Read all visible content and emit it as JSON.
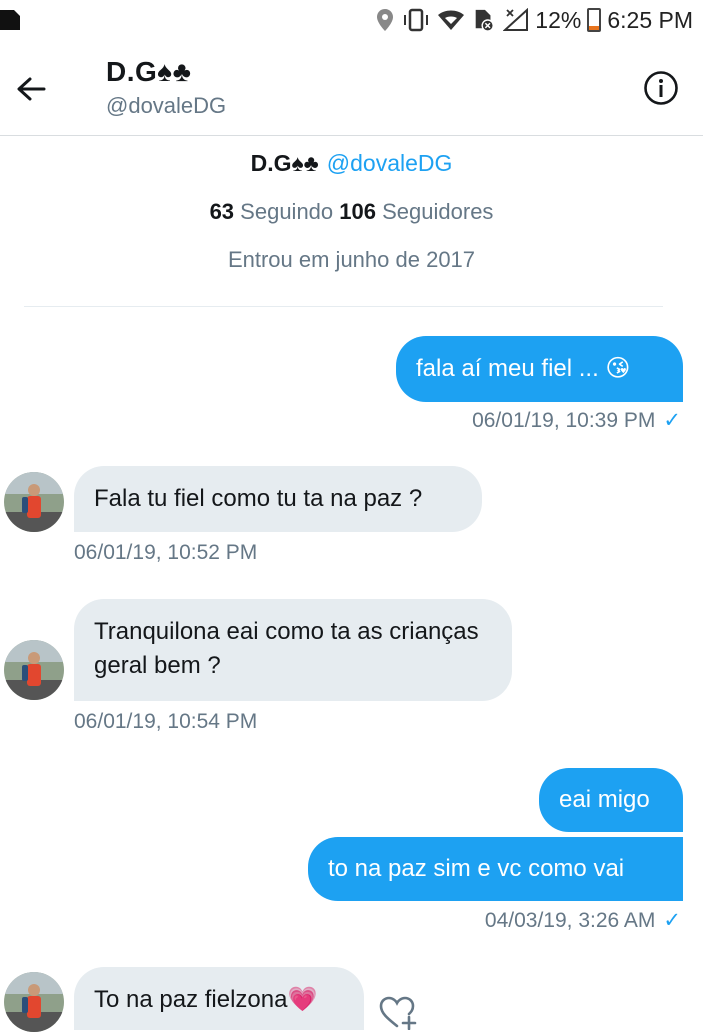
{
  "status_bar": {
    "battery": "12%",
    "battery_level": 0.12,
    "time": "6:25 PM",
    "icons": [
      "image-icon",
      "location-icon",
      "vibrate-icon",
      "wifi-icon",
      "data-off-icon",
      "signal-icon",
      "battery-icon"
    ]
  },
  "header": {
    "name": "D.G♠♣",
    "handle": "@dovaleDG",
    "back_icon": "arrow-left-icon",
    "info_icon": "info-icon"
  },
  "profile": {
    "name": "D.G♠♣",
    "handle": "@dovaleDG",
    "following_count": "63",
    "following_label": "Seguindo",
    "followers_count": "106",
    "followers_label": "Seguidores",
    "joined": "Entrou em junho de 2017"
  },
  "messages": [
    {
      "direction": "out",
      "text": "fala aí meu fiel ... 😘",
      "timestamp": "06/01/19, 10:39 PM",
      "read": true
    },
    {
      "direction": "in",
      "text": "Fala tu fiel como tu ta na paz ?",
      "timestamp": "06/01/19, 10:52 PM"
    },
    {
      "direction": "in",
      "text": "Tranquilona eai como ta as crianças geral bem ?",
      "timestamp": "06/01/19, 10:54 PM"
    },
    {
      "direction": "out",
      "text": "eai migo"
    },
    {
      "direction": "out",
      "text": "to na paz sim e vc como vai",
      "timestamp": "04/03/19, 3:26 AM",
      "read": true
    },
    {
      "direction": "in",
      "text": "To na paz fielzona💗"
    }
  ],
  "colors": {
    "accent": "#1da1f2",
    "incoming_bubble": "#e6ecf0",
    "secondary_text": "#657786"
  },
  "check_mark": "✓"
}
